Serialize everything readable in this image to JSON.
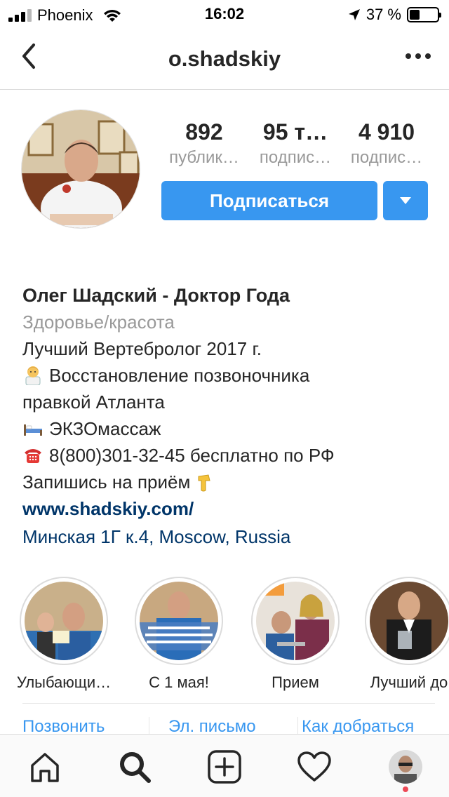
{
  "status_bar": {
    "carrier": "Phoenix",
    "time": "16:02",
    "battery_text": "37 %",
    "battery_level": 0.37
  },
  "nav": {
    "username": "o.shadskiy"
  },
  "stats": [
    {
      "value": "892",
      "label": "публик…"
    },
    {
      "value": "95 т…",
      "label": "подпис…"
    },
    {
      "value": "4 910",
      "label": "подпис…"
    }
  ],
  "actions": {
    "follow_label": "Подписаться"
  },
  "bio": {
    "name": "Олег Шадский - Доктор Года",
    "category": "Здоровье/красота",
    "line1": "Лучший Вертебролог 2017 г.",
    "line2a": "Восстановление позвоночника",
    "line2b": "правкой Атланта",
    "line3": "ЭКЗОмассаж",
    "line4": "8(800)301-32-45 бесплатно по РФ",
    "line5": "Запишись на приём",
    "website": "www.shadskiy.com/",
    "location": "Минская 1Г к.4, Moscow, Russia",
    "emoji_icons": [
      "doctor-emoji",
      "bed-emoji",
      "telephone-emoji",
      "pointing-down-emoji"
    ]
  },
  "highlights": [
    {
      "label": "Улыбающи…"
    },
    {
      "label": "С 1 мая!"
    },
    {
      "label": "Прием"
    },
    {
      "label": "Лучший до"
    }
  ],
  "contacts": {
    "call": "Позвонить",
    "email": "Эл. письмо",
    "directions": "Как добраться"
  },
  "tabs": [
    "home-icon",
    "search-icon",
    "add-post-icon",
    "heart-icon",
    "profile-avatar"
  ],
  "colors": {
    "accent": "#3897f0",
    "link": "#003569",
    "secondary_text": "#999999",
    "notification": "#ed4956"
  }
}
